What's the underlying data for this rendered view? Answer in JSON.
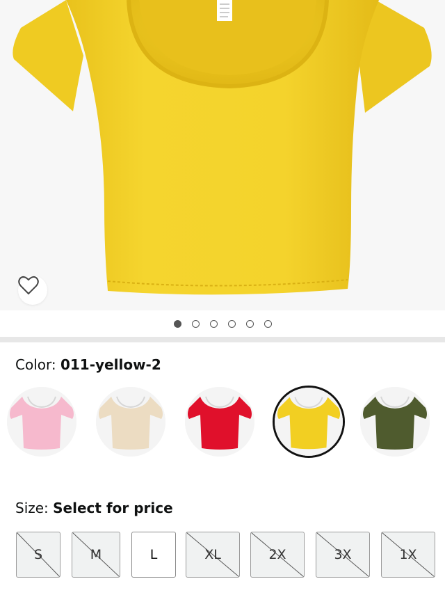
{
  "product": {
    "gallery": {
      "image_count": 6,
      "active_index": 0,
      "dot_labels": [
        "image-1",
        "image-2",
        "image-3",
        "image-4",
        "image-5",
        "image-6"
      ],
      "main_color": "#f3d22c"
    },
    "wishlist_icon": "heart-outline-icon"
  },
  "color": {
    "label": "Color:",
    "selected_value": "011-yellow-2",
    "swatches": [
      {
        "name": "pink",
        "color": "#f6b9cd",
        "selected": false
      },
      {
        "name": "beige",
        "color": "#ecdcc2",
        "selected": false
      },
      {
        "name": "red",
        "color": "#e0102b",
        "selected": false
      },
      {
        "name": "yellow",
        "color": "#f2cf22",
        "selected": true
      },
      {
        "name": "olive",
        "color": "#4f5b2e",
        "selected": false
      }
    ]
  },
  "size": {
    "label": "Size:",
    "selected_value": "Select for price",
    "options": [
      {
        "label": "S",
        "available": false
      },
      {
        "label": "M",
        "available": false
      },
      {
        "label": "L",
        "available": true
      },
      {
        "label": "XL",
        "available": false
      },
      {
        "label": "2X",
        "available": false
      },
      {
        "label": "3X",
        "available": false
      },
      {
        "label": "1X",
        "available": false
      }
    ]
  }
}
